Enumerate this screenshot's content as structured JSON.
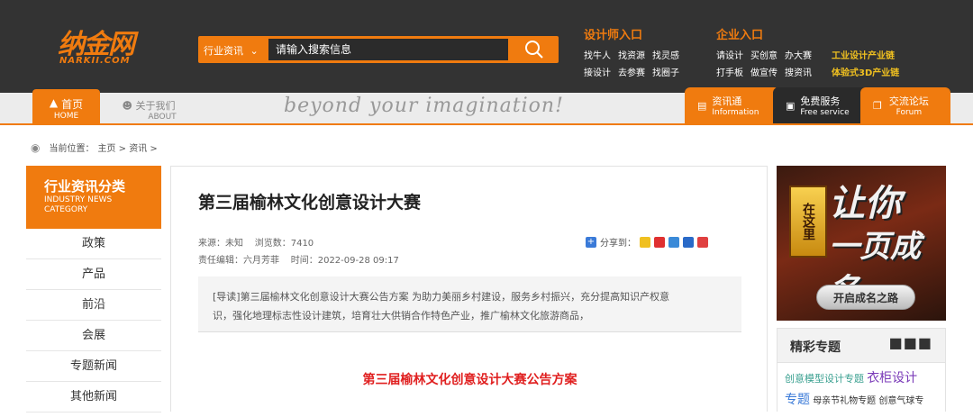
{
  "logo": {
    "cn": "纳金网",
    "en": "NARKII.COM"
  },
  "search": {
    "category": "行业资讯",
    "placeholder": "请输入搜索信息"
  },
  "designer": {
    "title": "设计师入口",
    "row1": [
      "找牛人",
      "找资源",
      "找灵感"
    ],
    "row2": [
      "接设计",
      "去参赛",
      "找圈子"
    ]
  },
  "enterprise": {
    "title": "企业入口",
    "row1": [
      "请设计",
      "买创意",
      "办大赛"
    ],
    "row2": [
      "打手板",
      "做宣传",
      "搜资讯"
    ],
    "extra1": "工业设计产业链",
    "extra2": "体验式3D产业链"
  },
  "nav": {
    "home_cn": "首页",
    "home_en": "HOME",
    "about_cn": "关于我们",
    "about_en": "ABOUT",
    "slogan": "beyond your imagination!",
    "info_cn": "资讯通",
    "info_en": "Information",
    "free_cn": "免费服务",
    "free_en": "Free service",
    "forum_cn": "交流论坛",
    "forum_en": "Forum"
  },
  "breadcrumb": {
    "label": "当前位置：",
    "path": "主页 > 资讯 >"
  },
  "sidebar": {
    "title_cn": "行业资讯分类",
    "title_en1": "INDUSTRY NEWS",
    "title_en2": "CATEGORY",
    "items": [
      "政策",
      "产品",
      "前沿",
      "会展",
      "专题新闻",
      "其他新闻"
    ]
  },
  "article": {
    "title": "第三届榆林文化创意设计大赛",
    "source": "来源：未知",
    "views": "浏览数：7410",
    "editor": "责任编辑：六月芳菲",
    "time": "时间：2022-09-28 09:17",
    "share_label": "分享到：",
    "intro_line1": "[导读]第三届榆林文化创意设计大赛公告方案 为助力美丽乡村建设，服务乡村振兴，充分提高知识产权意",
    "intro_line2": "识，强化地理标志性设计建筑，培育壮大供销合作特色产业，推广榆林文化旅游商品，",
    "subheading": "第三届榆林文化创意设计大赛公告方案"
  },
  "ad": {
    "zai": "在这里",
    "big1": "让你",
    "big2": "一页成名",
    "button": "开启成名之路"
  },
  "topics": {
    "title": "精彩专题",
    "tag1": "创意模型设计专题",
    "tag2": "衣柜设计",
    "tag3": "专题",
    "tag4": "母亲节礼物专题",
    "tag5": "创意气球专"
  },
  "colors": {
    "accent": "#f07b0f",
    "header_bg": "#333333",
    "headline_red": "#e02020"
  }
}
